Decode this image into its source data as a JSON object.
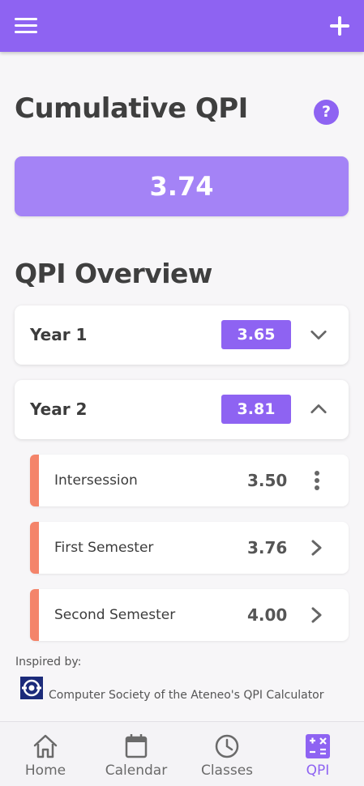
{
  "appbar": {
    "menu_icon": "hamburger-menu-icon",
    "add_icon": "plus-icon"
  },
  "header": {
    "title": "Cumulative QPI",
    "help_label": "?"
  },
  "cumulative": {
    "value": "3.74"
  },
  "overview": {
    "title": "QPI Overview",
    "years": [
      {
        "label": "Year 1",
        "qpi": "3.65",
        "expanded": false
      },
      {
        "label": "Year 2",
        "qpi": "3.81",
        "expanded": true
      }
    ],
    "semesters": [
      {
        "label": "Intersession",
        "qpi": "3.50",
        "action": "more-vertical-icon"
      },
      {
        "label": "First Semester",
        "qpi": "3.76",
        "action": "chevron-right-icon"
      },
      {
        "label": "Second Semester",
        "qpi": "4.00",
        "action": "chevron-right-icon"
      }
    ]
  },
  "footer": {
    "inspired_label": "Inspired by:",
    "credit": "Computer Society of the Ateneo's QPI Calculator"
  },
  "nav": {
    "items": [
      {
        "label": "Home",
        "icon": "home-icon"
      },
      {
        "label": "Calendar",
        "icon": "calendar-icon"
      },
      {
        "label": "Classes",
        "icon": "clock-icon"
      },
      {
        "label": "QPI",
        "icon": "calculator-icon",
        "active": true
      }
    ]
  },
  "colors": {
    "primary": "#8e63f2",
    "primary_light": "#a483f6",
    "accent_bar": "#f4846a"
  }
}
